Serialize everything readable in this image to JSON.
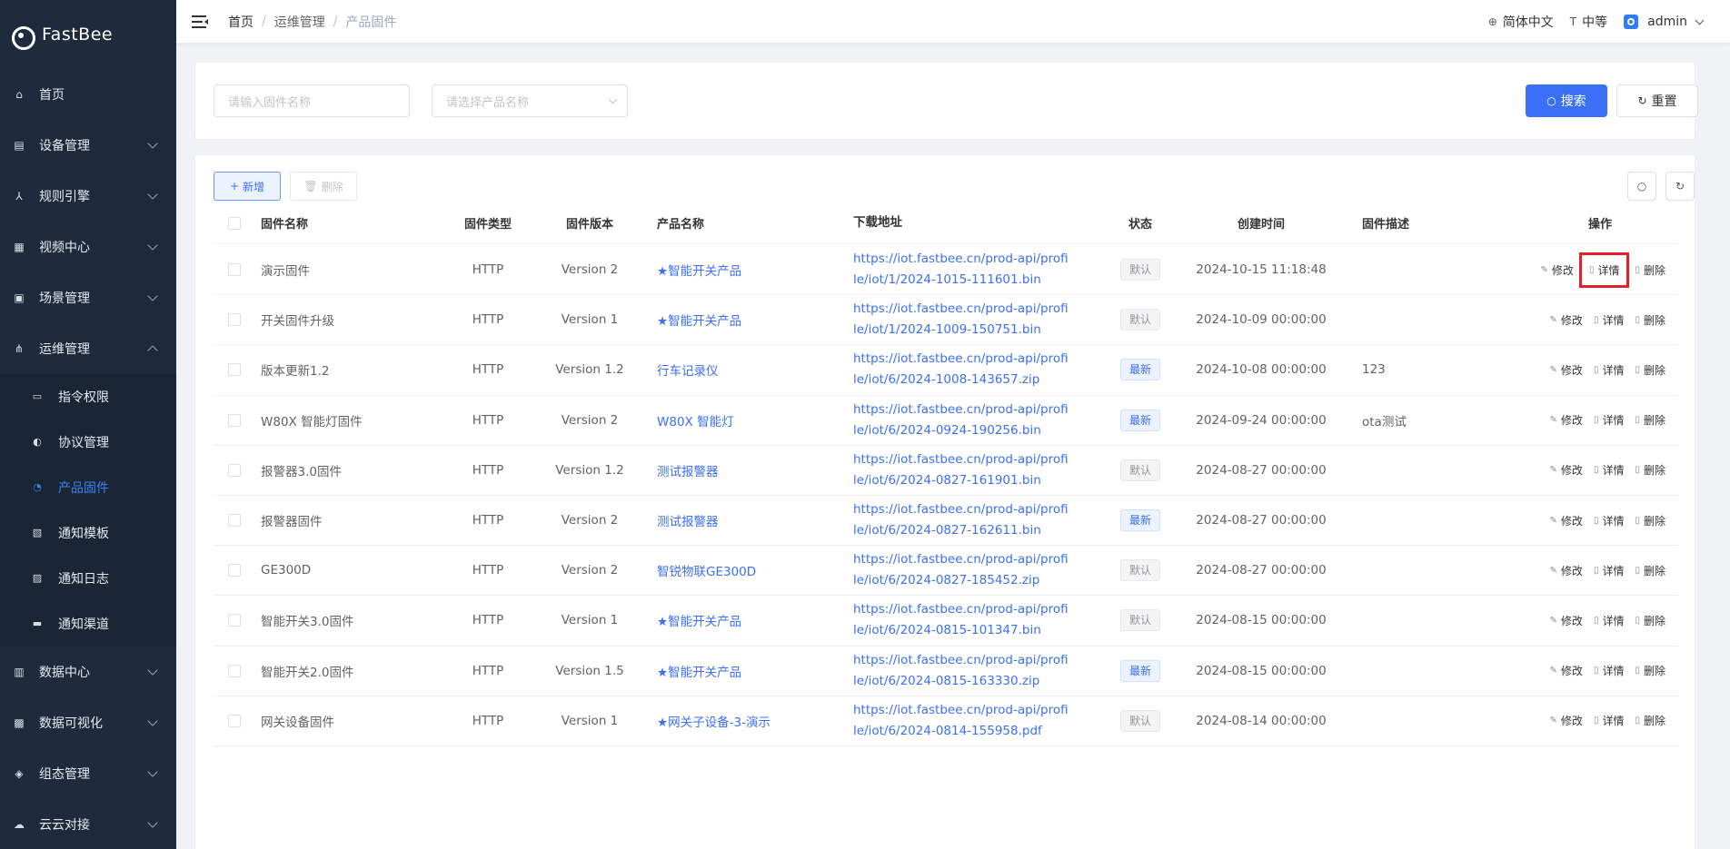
{
  "app": {
    "name": "FastBee"
  },
  "sidebar": {
    "items": [
      {
        "label": "首页",
        "icon": "home-icon",
        "expandable": false
      },
      {
        "label": "设备管理",
        "icon": "device-icon",
        "expandable": true
      },
      {
        "label": "规则引擎",
        "icon": "rule-icon",
        "expandable": true
      },
      {
        "label": "视频中心",
        "icon": "video-icon",
        "expandable": true
      },
      {
        "label": "场景管理",
        "icon": "scene-icon",
        "expandable": true
      },
      {
        "label": "运维管理",
        "icon": "ops-icon",
        "expandable": true,
        "expanded": true
      },
      {
        "label": "数据中心",
        "icon": "data-icon",
        "expandable": true
      },
      {
        "label": "数据可视化",
        "icon": "visual-icon",
        "expandable": true
      },
      {
        "label": "组态管理",
        "icon": "config-icon",
        "expandable": true
      },
      {
        "label": "云云对接",
        "icon": "cloud-icon",
        "expandable": true
      }
    ],
    "ops_sub": [
      {
        "label": "指令权限",
        "icon": "command-icon"
      },
      {
        "label": "协议管理",
        "icon": "protocol-icon"
      },
      {
        "label": "产品固件",
        "icon": "firmware-icon",
        "active": true
      },
      {
        "label": "通知模板",
        "icon": "template-icon"
      },
      {
        "label": "通知日志",
        "icon": "log-icon"
      },
      {
        "label": "通知渠道",
        "icon": "channel-icon"
      }
    ]
  },
  "topbar": {
    "breadcrumb": [
      "首页",
      "运维管理",
      "产品固件"
    ],
    "language": "简体中文",
    "size": "中等",
    "user": "admin"
  },
  "search": {
    "firmware_placeholder": "请输入固件名称",
    "product_placeholder": "请选择产品名称",
    "search_label": "搜索",
    "reset_label": "重置"
  },
  "toolbar": {
    "add_label": "新增",
    "delete_label": "删除"
  },
  "table": {
    "headers": [
      "固件名称",
      "固件类型",
      "固件版本",
      "产品名称",
      "下载地址",
      "状态",
      "创建时间",
      "固件描述",
      "操作"
    ],
    "op_labels": {
      "edit": "修改",
      "detail": "详情",
      "delete": "删除"
    },
    "rows": [
      {
        "name": "演示固件",
        "type": "HTTP",
        "version": "Version 2",
        "product": "★智能开关产品",
        "url": "https://iot.fastbee.cn/prod-api/profile/iot/1/2024-1015-111601.bin",
        "status": "默认",
        "status_kind": "default",
        "time": "2024-10-15 11:18:48",
        "desc": ""
      },
      {
        "name": "开关固件升级",
        "type": "HTTP",
        "version": "Version 1",
        "product": "★智能开关产品",
        "url": "https://iot.fastbee.cn/prod-api/profile/iot/1/2024-1009-150751.bin",
        "status": "默认",
        "status_kind": "default",
        "time": "2024-10-09 00:00:00",
        "desc": ""
      },
      {
        "name": "版本更新1.2",
        "type": "HTTP",
        "version": "Version 1.2",
        "product": "行车记录仪",
        "url": "https://iot.fastbee.cn/prod-api/profile/iot/6/2024-1008-143657.zip",
        "status": "最新",
        "status_kind": "new",
        "time": "2024-10-08 00:00:00",
        "desc": "123"
      },
      {
        "name": "W80X 智能灯固件",
        "type": "HTTP",
        "version": "Version 2",
        "product": "W80X 智能灯",
        "url": "https://iot.fastbee.cn/prod-api/profile/iot/6/2024-0924-190256.bin",
        "status": "最新",
        "status_kind": "new",
        "time": "2024-09-24 00:00:00",
        "desc": "ota测试"
      },
      {
        "name": "报警器3.0固件",
        "type": "HTTP",
        "version": "Version 1.2",
        "product": "测试报警器",
        "url": "https://iot.fastbee.cn/prod-api/profile/iot/6/2024-0827-161901.bin",
        "status": "默认",
        "status_kind": "default",
        "time": "2024-08-27 00:00:00",
        "desc": ""
      },
      {
        "name": "报警器固件",
        "type": "HTTP",
        "version": "Version 2",
        "product": "测试报警器",
        "url": "https://iot.fastbee.cn/prod-api/profile/iot/6/2024-0827-162611.bin",
        "status": "最新",
        "status_kind": "new",
        "time": "2024-08-27 00:00:00",
        "desc": ""
      },
      {
        "name": "GE300D",
        "type": "HTTP",
        "version": "Version 2",
        "product": "智锐物联GE300D",
        "url": "https://iot.fastbee.cn/prod-api/profile/iot/6/2024-0827-185452.zip",
        "status": "默认",
        "status_kind": "default",
        "time": "2024-08-27 00:00:00",
        "desc": ""
      },
      {
        "name": "智能开关3.0固件",
        "type": "HTTP",
        "version": "Version 1",
        "product": "★智能开关产品",
        "url": "https://iot.fastbee.cn/prod-api/profile/iot/6/2024-0815-101347.bin",
        "status": "默认",
        "status_kind": "default",
        "time": "2024-08-15 00:00:00",
        "desc": ""
      },
      {
        "name": "智能开关2.0固件",
        "type": "HTTP",
        "version": "Version 1.5",
        "product": "★智能开关产品",
        "url": "https://iot.fastbee.cn/prod-api/profile/iot/6/2024-0815-163330.zip",
        "status": "最新",
        "status_kind": "new",
        "time": "2024-08-15 00:00:00",
        "desc": ""
      },
      {
        "name": "网关设备固件",
        "type": "HTTP",
        "version": "Version 1",
        "product": "★网关子设备-3-演示",
        "url": "https://iot.fastbee.cn/prod-api/profile/iot/6/2024-0814-155958.pdf",
        "status": "默认",
        "status_kind": "default",
        "time": "2024-08-14 00:00:00",
        "desc": ""
      }
    ]
  },
  "colors": {
    "sidebar_bg": "#1e2b3c",
    "accent": "#3b6ff5",
    "highlight": "#e0202a"
  }
}
